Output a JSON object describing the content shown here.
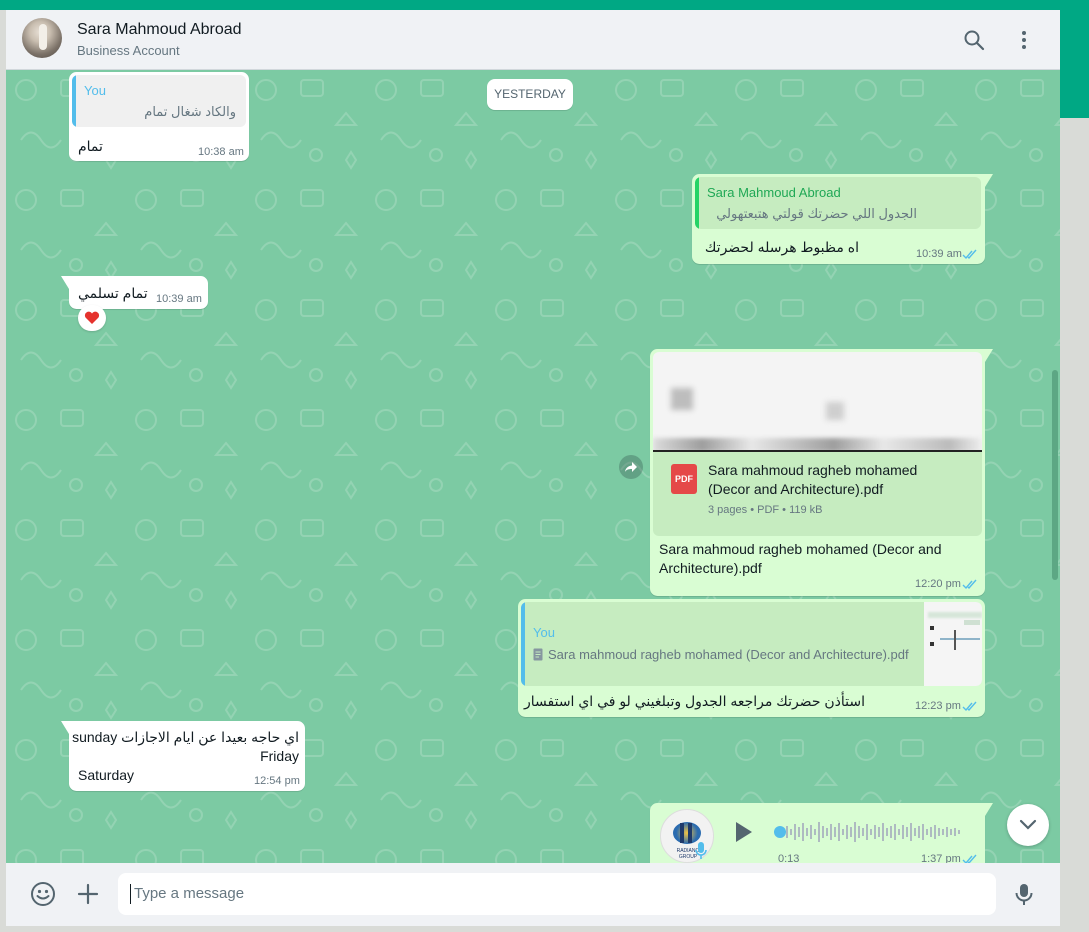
{
  "header": {
    "contact_name": "Sara Mahmoud Abroad",
    "subtitle": "Business Account",
    "icons": [
      "search-icon",
      "menu-kebab-icon"
    ]
  },
  "chat": {
    "date_divider": "YESTERDAY",
    "messages": [
      {
        "direction": "incoming",
        "quote": {
          "author": "You",
          "text": "والكاد شغال تمام"
        },
        "text": "تمام",
        "time": "10:38 am"
      },
      {
        "direction": "outgoing",
        "quote": {
          "author": "Sara Mahmoud Abroad",
          "text": "الجدول اللي حضرتك قولتي هتبعتهولي"
        },
        "text": "اه مظبوط هرسله لحضرتك",
        "time": "10:39 am",
        "status": "read"
      },
      {
        "direction": "incoming",
        "text": "تمام تسلمي",
        "time": "10:39 am",
        "reaction": "❤"
      },
      {
        "direction": "outgoing",
        "document": {
          "name": "Sara mahmoud ragheb mohamed (Decor and Architecture).pdf",
          "name_line1": "Sara mahmoud ragheb mohamed",
          "name_line2": "(Decor and Architecture).pdf",
          "meta": "3 pages • PDF • 119 kB",
          "badge": "PDF"
        },
        "caption_line1": "Sara mahmoud ragheb mohamed (Decor and",
        "caption_line2": "Architecture).pdf",
        "time": "12:20 pm",
        "status": "read"
      },
      {
        "direction": "outgoing",
        "quote": {
          "author": "You",
          "text": "Sara mahmoud ragheb mohamed (Decor and Architecture).pdf"
        },
        "text": "استأذن حضرتك مراجعه الجدول وتبلغيني لو في اي استفسار",
        "time": "12:23 pm",
        "status": "read"
      },
      {
        "direction": "incoming",
        "line1": "اي حاجه بعيدا عن ايام الاجازات sunday",
        "line2": "Friday",
        "line3": "Saturday",
        "time": "12:54 pm"
      },
      {
        "direction": "outgoing",
        "voice": {
          "duration": "0:13",
          "progress": 0.0,
          "avatar_text": "RADIANO GROUP"
        },
        "time": "1:37 pm",
        "status": "read"
      }
    ]
  },
  "composer": {
    "placeholder": "Type a message",
    "icons": [
      "emoji-icon",
      "attach-plus-icon",
      "microphone-icon"
    ]
  },
  "colors": {
    "accent": "#00a884",
    "chat_bg": "#7ccaa3",
    "outgoing_bubble": "#d9fdd3",
    "incoming_bubble": "#ffffff",
    "quote_you": "#53bdeb",
    "quote_contact": "#25d366",
    "tick_read": "#53bdeb",
    "pdf_red": "#e54848"
  }
}
